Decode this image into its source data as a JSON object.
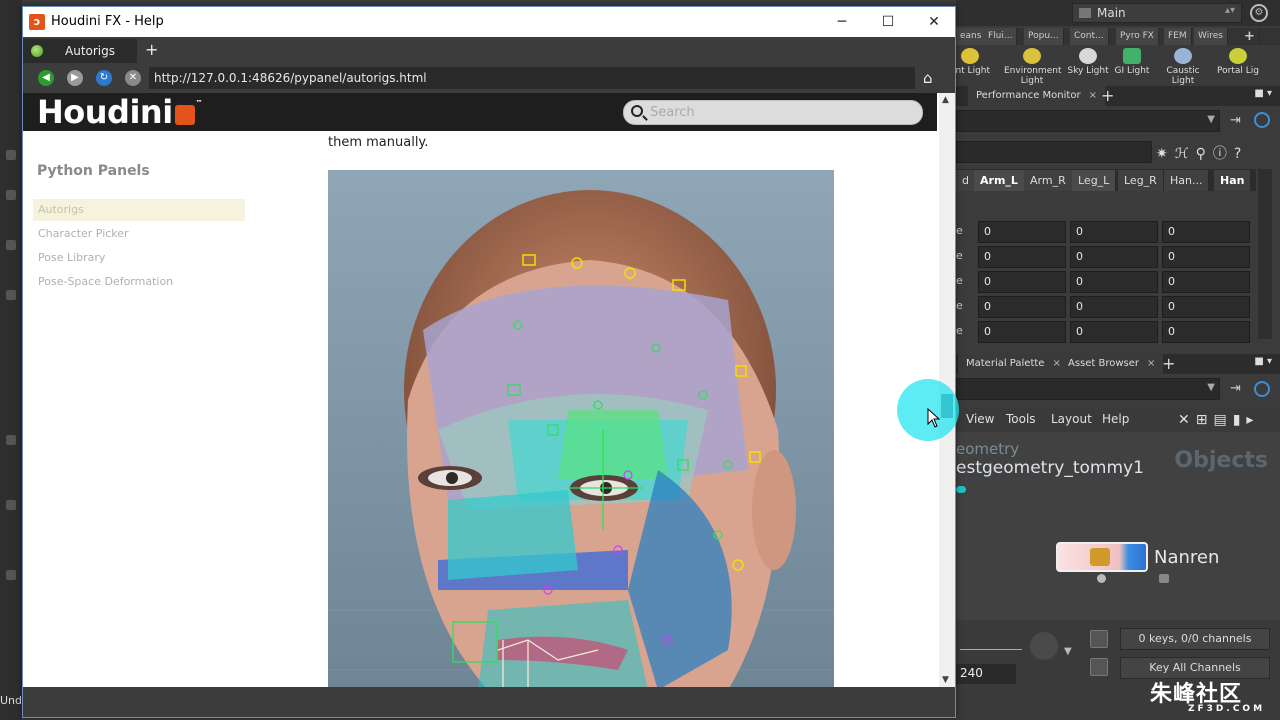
{
  "help_window": {
    "title": "Houdini FX - Help",
    "controls": {
      "minimize": "─",
      "maximize": "☐",
      "close": "✕"
    },
    "tab": {
      "label": "Autorigs",
      "new_tab": "+"
    },
    "url": "http://127.0.0.1:48626/pypanel/autorigs.html",
    "page": {
      "logo": "Houdini",
      "logo_tm": "™",
      "search_placeholder": "Search",
      "sidebar_title": "Python Panels",
      "sidebar_items": [
        "Autorigs",
        "Character Picker",
        "Pose Library",
        "Pose-Space Deformation"
      ],
      "body_text": "them manually."
    }
  },
  "bg_app": {
    "desktop": "Main",
    "shelf_tabs": [
      "eans",
      "Flui...",
      "Popu...",
      "Cont...",
      "Pyro FX",
      "FEM",
      "Wires",
      "+"
    ],
    "shelf_tools": [
      "ant Light",
      "Environment Light",
      "Sky Light",
      "GI Light",
      "Caustic Light",
      "Portal Lig"
    ],
    "perf_tab": "Performance Monitor",
    "channel_tabs": [
      "d",
      "Arm_L",
      "Arm_R",
      "Leg_L",
      "Leg_R",
      "Han...",
      "Han"
    ],
    "spreadsheet_label": "e",
    "spreadsheet_value": "0",
    "lower_tabs": [
      "Material Palette",
      "Asset Browser"
    ],
    "menus": [
      "View",
      "Tools",
      "Layout",
      "Help"
    ],
    "net_path1": "eometry",
    "net_path2": "estgeometry_tommy1",
    "net_context": "Objects",
    "node_name": "Nanren",
    "frame_end": "240",
    "keys_status": "0 keys, 0/0 channels",
    "key_all": "Key All Channels",
    "watermark": "朱峰社区",
    "watermark_sub": "ZF3D.COM",
    "left_edge_text": "Und"
  }
}
